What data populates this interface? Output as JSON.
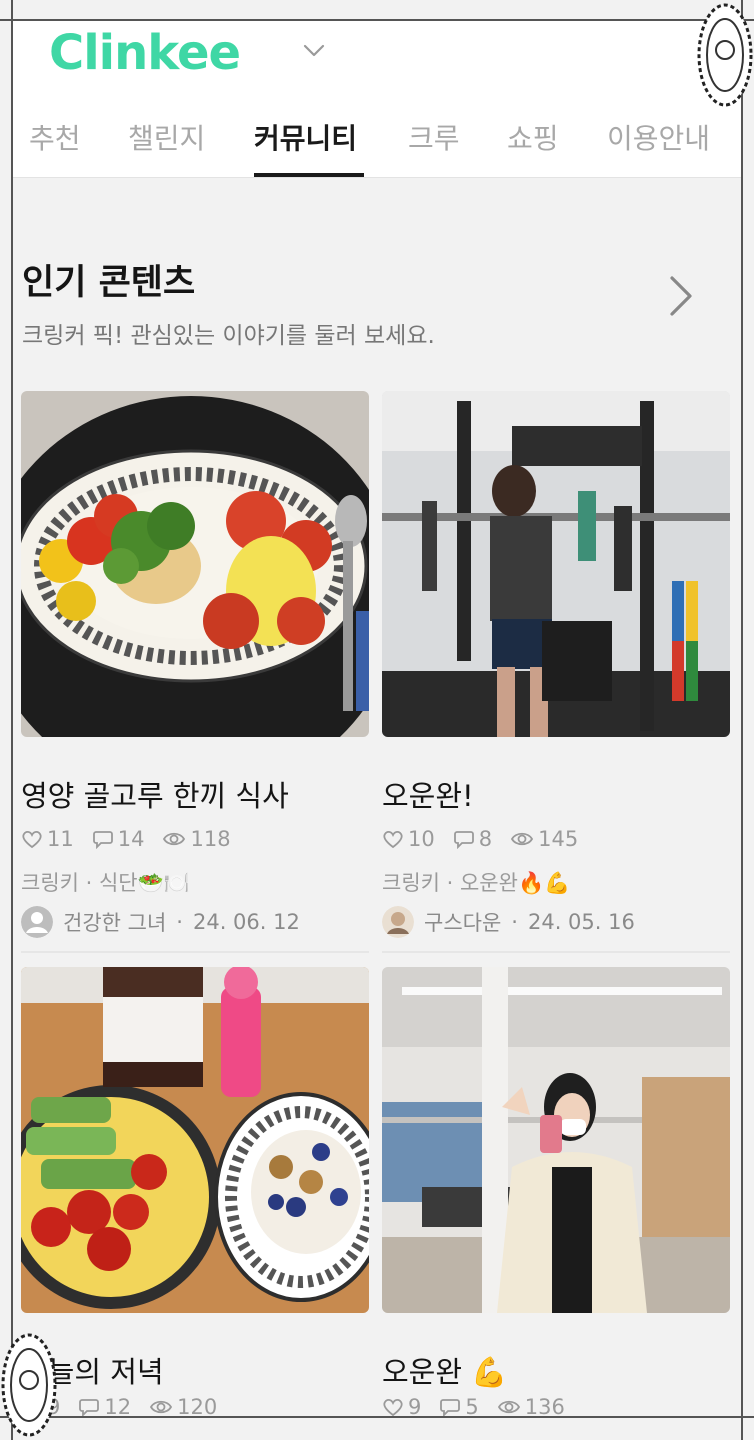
{
  "header": {
    "logo": "Clinkee",
    "tabs": [
      {
        "label": "추천"
      },
      {
        "label": "챌린지"
      },
      {
        "label": "커뮤니티"
      },
      {
        "label": "크루"
      },
      {
        "label": "쇼핑"
      },
      {
        "label": "이용안내"
      }
    ],
    "active_tab": 2
  },
  "section": {
    "title": "인기 콘텐츠",
    "subtitle": "크링커 픽! 관심있는 이야기를 둘러 보세요."
  },
  "cards": [
    {
      "title": "영양 골고루 한끼 식사",
      "likes": "11",
      "comments": "14",
      "views": "118",
      "tagline": "크링키 · 식단🥗🍽️",
      "author": "건강한 그녀",
      "date": "24. 06. 12"
    },
    {
      "title": "오운완!",
      "likes": "10",
      "comments": "8",
      "views": "145",
      "tagline": "크링키 · 오운완🔥💪",
      "author": "구스다운",
      "date": "24. 05. 16"
    },
    {
      "title": "오늘의 저녁",
      "likes": "9",
      "comments": "12",
      "views": "120"
    },
    {
      "title": "오운완 💪",
      "likes": "9",
      "comments": "5",
      "views": "136"
    }
  ],
  "colors": {
    "brand": "#3fd7a5",
    "background": "#f2f2f2",
    "muted_text": "#9a9a9a"
  },
  "icons": [
    "chevron-down-icon",
    "chevron-right-icon",
    "heart-icon",
    "comment-icon",
    "eye-icon",
    "avatar-icon"
  ]
}
